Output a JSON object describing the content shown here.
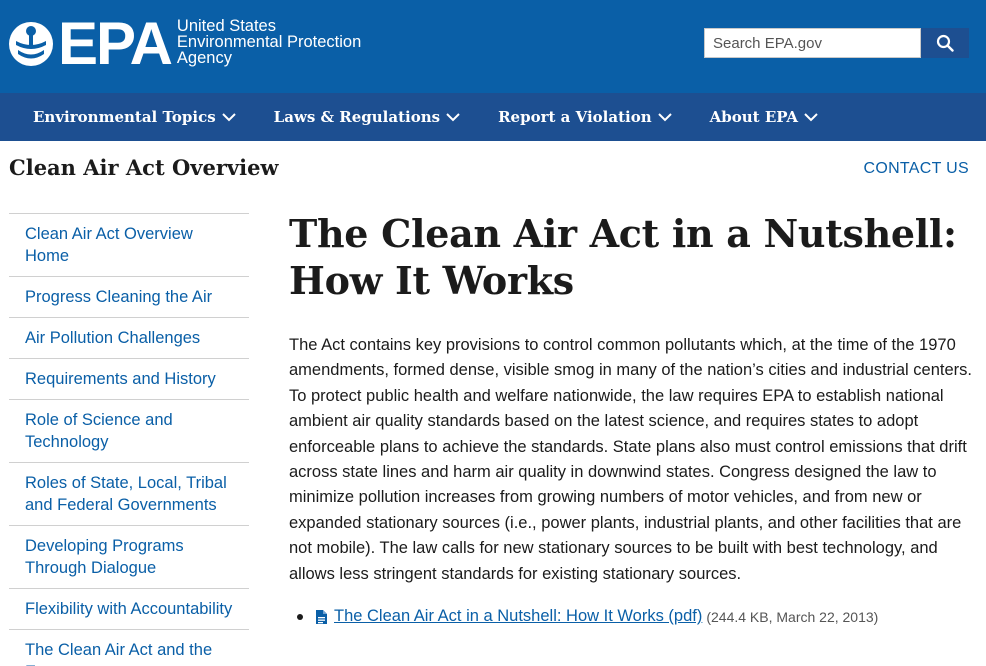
{
  "header": {
    "logo_text": "EPA",
    "agency_line1": "United States",
    "agency_line2": "Environmental Protection",
    "agency_line3": "Agency",
    "search_placeholder": "Search EPA.gov",
    "search_icon": "search-icon",
    "brand_color": "#0a5fa7",
    "nav_color": "#1d4f91"
  },
  "nav": {
    "items": [
      {
        "label": "Environmental Topics"
      },
      {
        "label": "Laws & Regulations"
      },
      {
        "label": "Report a Violation"
      },
      {
        "label": "About EPA"
      }
    ]
  },
  "page": {
    "title": "Clean Air Act Overview",
    "contact": "CONTACT US"
  },
  "sidebar": {
    "items": [
      {
        "label": "Clean Air Act Overview Home"
      },
      {
        "label": "Progress Cleaning the Air"
      },
      {
        "label": "Air Pollution Challenges"
      },
      {
        "label": "Requirements and History"
      },
      {
        "label": "Role of Science and Technology"
      },
      {
        "label": "Roles of State, Local, Tribal and Federal Governments"
      },
      {
        "label": "Developing Programs Through Dialogue"
      },
      {
        "label": "Flexibility with Accountability"
      },
      {
        "label": "The Clean Air Act and the Economy"
      }
    ]
  },
  "main": {
    "heading": "The Clean Air Act in a Nutshell: How It Works",
    "body": "The Act contains key provisions to control common pollutants which, at the time of the 1970 amendments, formed dense, visible smog in many of the nation’s cities and industrial centers. To protect public health and welfare nationwide, the law requires EPA to establish national ambient air quality standards based on the latest science, and requires states to adopt enforceable plans to achieve the standards. State plans also must control emissions that drift across state lines and harm air quality in downwind states. Congress designed the law to minimize pollution increases from growing numbers of motor vehicles, and from new or expanded stationary sources (i.e., power plants, industrial plants, and other facilities that are not mobile). The law calls for new stationary sources to be built with best technology, and allows less stringent standards for existing stationary sources.",
    "file": {
      "icon": "file-pdf-icon",
      "link": "The Clean Air Act in a Nutshell: How It Works (pdf)",
      "meta": "(244.4 KB, March 22, 2013)"
    }
  }
}
